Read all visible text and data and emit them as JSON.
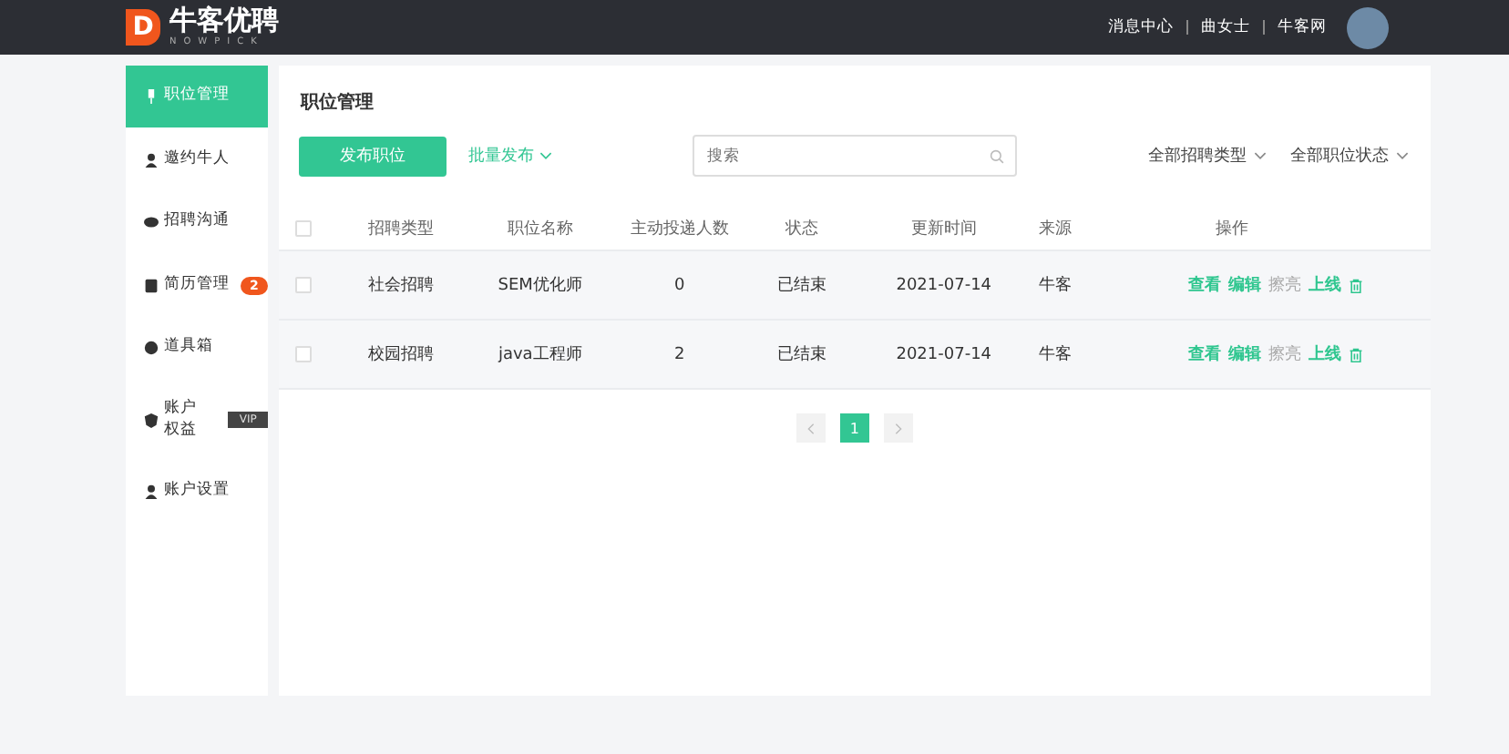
{
  "header": {
    "logo_mark": "D",
    "logo_text": "牛客优聘",
    "logo_sub": "NOWPICK",
    "links": [
      "消息中心",
      "曲女士",
      "牛客网"
    ]
  },
  "sidebar": {
    "items": [
      {
        "label": "职位管理",
        "selected": true
      },
      {
        "label": "邀约牛人",
        "selected": false
      },
      {
        "label": "招聘沟通",
        "selected": false
      },
      {
        "label": "简历管理",
        "selected": false,
        "badge": "2"
      },
      {
        "label": "道具箱",
        "selected": false
      },
      {
        "label": "账户权益",
        "selected": false,
        "tag": "VIP"
      },
      {
        "label": "账户设置",
        "selected": false
      }
    ]
  },
  "main": {
    "title": "职位管理",
    "publish_button": "发布职位",
    "batch_publish": "批量发布",
    "search": {
      "placeholder": "搜索"
    },
    "filters": [
      "全部招聘类型",
      "全部职位状态"
    ],
    "table": {
      "all_checked": false,
      "columns": [
        "招聘类型",
        "职位名称",
        "主动投递人数",
        "状态",
        "更新时间",
        "来源",
        "操作"
      ],
      "rows": [
        {
          "checked": false,
          "cells": [
            "社会招聘",
            "SEM优化师",
            "0",
            "已结束",
            "2021-07-14",
            "牛客"
          ],
          "actions": [
            {
              "label": "查看",
              "disabled": false
            },
            {
              "label": "编辑",
              "disabled": false
            },
            {
              "label": "擦亮",
              "disabled": true
            },
            {
              "label": "上线",
              "disabled": false
            }
          ]
        },
        {
          "checked": false,
          "cells": [
            "校园招聘",
            "java工程师",
            "2",
            "已结束",
            "2021-07-14",
            "牛客"
          ],
          "actions": [
            {
              "label": "查看",
              "disabled": false
            },
            {
              "label": "编辑",
              "disabled": false
            },
            {
              "label": "擦亮",
              "disabled": true
            },
            {
              "label": "上线",
              "disabled": false
            }
          ]
        }
      ]
    },
    "pagination": {
      "pages": [
        {
          "label": "1",
          "selected": true
        }
      ]
    }
  }
}
